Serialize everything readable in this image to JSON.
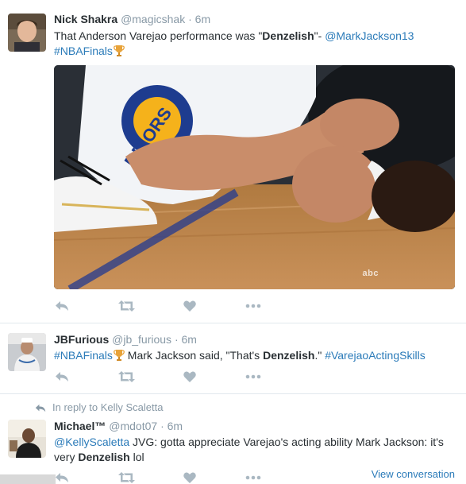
{
  "tweets": [
    {
      "fullname": "Nick Shakra",
      "username": "@magicshak",
      "separator": "·",
      "time": "6m",
      "text_pre": "That Anderson Varejao performance was \"",
      "text_bold": "Denzelish",
      "text_post": "\"- ",
      "mention": "@MarkJackson13",
      "hashtag": "#NBAFinals"
    },
    {
      "fullname": "JBFurious",
      "username": "@jb_furious",
      "separator": "·",
      "time": "6m",
      "hashtag": "#NBAFinals",
      "text_pre": " Mark Jackson said, \"That's ",
      "text_bold": "Denzelish",
      "text_post": ".\" ",
      "hashtag2": "#VarejaoActingSkills"
    },
    {
      "reply_context": "In reply to Kelly Scaletta",
      "fullname": "Michael™",
      "username": "@mdot07",
      "separator": "·",
      "time": "6m",
      "mention": "@KellyScaletta",
      "text_pre": " JVG: gotta appreciate Varejao's acting ability Mark Jackson: it's very ",
      "text_bold": "Denzelish",
      "text_post": " lol",
      "view_conversation": "View conversation"
    }
  ],
  "media": {
    "watermark": "abc"
  },
  "icons": {
    "reply": "reply-icon",
    "retweet": "retweet-icon",
    "like": "heart-icon",
    "more": "more-icon",
    "trophy": "trophy-emoji"
  },
  "colors": {
    "link": "#2b7bb9",
    "muted": "#8899a6",
    "text": "#292f33",
    "icon": "#aab8c2",
    "border": "#e1e8ed"
  }
}
